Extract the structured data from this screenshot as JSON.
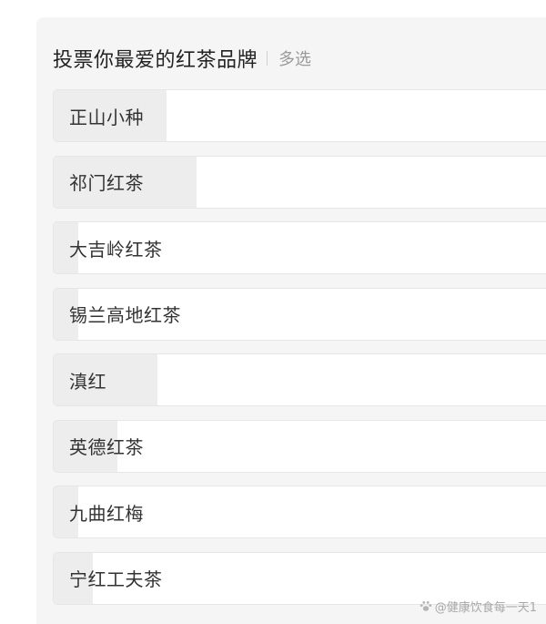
{
  "poll": {
    "title": "投票你最爱的红茶品牌",
    "mode": "多选",
    "options": [
      {
        "label": "正山小种",
        "share": 0.23
      },
      {
        "label": "祁门红茶",
        "share": 0.29
      },
      {
        "label": "大吉岭红茶",
        "share": 0.05
      },
      {
        "label": "锡兰高地红茶",
        "share": 0.05
      },
      {
        "label": "滇红",
        "share": 0.21
      },
      {
        "label": "英德红茶",
        "share": 0.13
      },
      {
        "label": "九曲红梅",
        "share": 0.05
      },
      {
        "label": "宁红工夫茶",
        "share": 0.08
      }
    ]
  },
  "watermark": {
    "text": "@健康饮食每一天1",
    "icon": "paw-icon"
  },
  "colors": {
    "card_bg": "#f5f5f5",
    "option_bg": "#ffffff",
    "fill": "#ededed",
    "text": "#333333",
    "muted": "#9a9a9a"
  }
}
